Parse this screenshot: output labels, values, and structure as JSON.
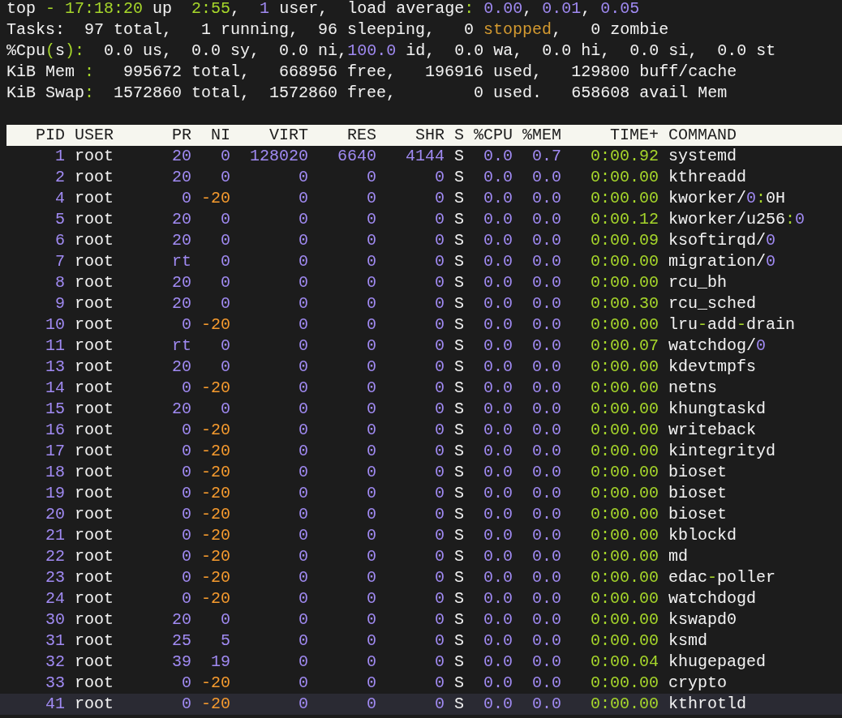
{
  "summary": [
    [
      {
        "text": "top ",
        "kind": "text"
      },
      {
        "text": "-",
        "kind": "accent"
      },
      {
        "text": " 17:18:20",
        "kind": "accent"
      },
      {
        "text": " up  ",
        "kind": "text"
      },
      {
        "text": "2:55",
        "kind": "accent"
      },
      {
        "text": ",  ",
        "kind": "text"
      },
      {
        "text": "1",
        "kind": "num"
      },
      {
        "text": " user,  load average",
        "kind": "text"
      },
      {
        "text": ":",
        "kind": "accent"
      },
      {
        "text": " 0.00",
        "kind": "num"
      },
      {
        "text": ", ",
        "kind": "text"
      },
      {
        "text": "0.01",
        "kind": "num"
      },
      {
        "text": ", ",
        "kind": "text"
      },
      {
        "text": "0.05",
        "kind": "num"
      }
    ],
    [
      {
        "text": "Tasks:  97 total,   1 running,  96 sleeping,   0 ",
        "kind": "text"
      },
      {
        "text": "stopped",
        "kind": "warn"
      },
      {
        "text": ",   0 zombie",
        "kind": "text"
      }
    ],
    [
      {
        "text": "%Cpu",
        "kind": "text"
      },
      {
        "text": "(",
        "kind": "accent"
      },
      {
        "text": "s",
        "kind": "text"
      },
      {
        "text": "):",
        "kind": "accent"
      },
      {
        "text": "  0.0 us,  0.0 sy,  0.0 ni,",
        "kind": "text"
      },
      {
        "text": "100.0",
        "kind": "num"
      },
      {
        "text": " id,  0.0 wa,  0.0 hi,  0.0 si,  0.0 st",
        "kind": "text"
      }
    ],
    [
      {
        "text": "KiB Mem ",
        "kind": "text"
      },
      {
        "text": ":",
        "kind": "accent"
      },
      {
        "text": "   995672 total,   668956 free,   196916 used,   129800 buff/cache",
        "kind": "text"
      }
    ],
    [
      {
        "text": "KiB Swap",
        "kind": "text"
      },
      {
        "text": ":",
        "kind": "accent"
      },
      {
        "text": "  1572860 total,  1572860 free,        0 used.   658608 avail Mem",
        "kind": "text"
      }
    ]
  ],
  "table": {
    "columns": [
      {
        "label": "PID",
        "kind": "num"
      },
      {
        "label": "USER",
        "kind": "text"
      },
      {
        "label": "PR",
        "kind": "num"
      },
      {
        "label": "NI",
        "kind": "signed"
      },
      {
        "label": "VIRT",
        "kind": "num"
      },
      {
        "label": "RES",
        "kind": "num"
      },
      {
        "label": "SHR",
        "kind": "num"
      },
      {
        "label": "S",
        "kind": "state"
      },
      {
        "label": "%CPU",
        "kind": "num"
      },
      {
        "label": "%MEM",
        "kind": "num"
      },
      {
        "label": "TIME+",
        "kind": "time"
      },
      {
        "label": "COMMAND",
        "kind": "command"
      }
    ],
    "rows": [
      {
        "cells": [
          "1",
          "root",
          "20",
          "0",
          "128020",
          "6640",
          "4144",
          "S",
          "0.0",
          "0.7",
          "0:00.92",
          "systemd"
        ],
        "selected": false
      },
      {
        "cells": [
          "2",
          "root",
          "20",
          "0",
          "0",
          "0",
          "0",
          "S",
          "0.0",
          "0.0",
          "0:00.00",
          "kthreadd"
        ],
        "selected": false
      },
      {
        "cells": [
          "4",
          "root",
          "0",
          "-20",
          "0",
          "0",
          "0",
          "S",
          "0.0",
          "0.0",
          "0:00.00",
          "kworker/0:0H"
        ],
        "selected": false
      },
      {
        "cells": [
          "5",
          "root",
          "20",
          "0",
          "0",
          "0",
          "0",
          "S",
          "0.0",
          "0.0",
          "0:00.12",
          "kworker/u256:0"
        ],
        "selected": false
      },
      {
        "cells": [
          "6",
          "root",
          "20",
          "0",
          "0",
          "0",
          "0",
          "S",
          "0.0",
          "0.0",
          "0:00.09",
          "ksoftirqd/0"
        ],
        "selected": false
      },
      {
        "cells": [
          "7",
          "root",
          "rt",
          "0",
          "0",
          "0",
          "0",
          "S",
          "0.0",
          "0.0",
          "0:00.00",
          "migration/0"
        ],
        "selected": false
      },
      {
        "cells": [
          "8",
          "root",
          "20",
          "0",
          "0",
          "0",
          "0",
          "S",
          "0.0",
          "0.0",
          "0:00.00",
          "rcu_bh"
        ],
        "selected": false
      },
      {
        "cells": [
          "9",
          "root",
          "20",
          "0",
          "0",
          "0",
          "0",
          "S",
          "0.0",
          "0.0",
          "0:00.30",
          "rcu_sched"
        ],
        "selected": false
      },
      {
        "cells": [
          "10",
          "root",
          "0",
          "-20",
          "0",
          "0",
          "0",
          "S",
          "0.0",
          "0.0",
          "0:00.00",
          "lru-add-drain"
        ],
        "selected": false
      },
      {
        "cells": [
          "11",
          "root",
          "rt",
          "0",
          "0",
          "0",
          "0",
          "S",
          "0.0",
          "0.0",
          "0:00.07",
          "watchdog/0"
        ],
        "selected": false
      },
      {
        "cells": [
          "13",
          "root",
          "20",
          "0",
          "0",
          "0",
          "0",
          "S",
          "0.0",
          "0.0",
          "0:00.00",
          "kdevtmpfs"
        ],
        "selected": false
      },
      {
        "cells": [
          "14",
          "root",
          "0",
          "-20",
          "0",
          "0",
          "0",
          "S",
          "0.0",
          "0.0",
          "0:00.00",
          "netns"
        ],
        "selected": false
      },
      {
        "cells": [
          "15",
          "root",
          "20",
          "0",
          "0",
          "0",
          "0",
          "S",
          "0.0",
          "0.0",
          "0:00.00",
          "khungtaskd"
        ],
        "selected": false
      },
      {
        "cells": [
          "16",
          "root",
          "0",
          "-20",
          "0",
          "0",
          "0",
          "S",
          "0.0",
          "0.0",
          "0:00.00",
          "writeback"
        ],
        "selected": false
      },
      {
        "cells": [
          "17",
          "root",
          "0",
          "-20",
          "0",
          "0",
          "0",
          "S",
          "0.0",
          "0.0",
          "0:00.00",
          "kintegrityd"
        ],
        "selected": false
      },
      {
        "cells": [
          "18",
          "root",
          "0",
          "-20",
          "0",
          "0",
          "0",
          "S",
          "0.0",
          "0.0",
          "0:00.00",
          "bioset"
        ],
        "selected": false
      },
      {
        "cells": [
          "19",
          "root",
          "0",
          "-20",
          "0",
          "0",
          "0",
          "S",
          "0.0",
          "0.0",
          "0:00.00",
          "bioset"
        ],
        "selected": false
      },
      {
        "cells": [
          "20",
          "root",
          "0",
          "-20",
          "0",
          "0",
          "0",
          "S",
          "0.0",
          "0.0",
          "0:00.00",
          "bioset"
        ],
        "selected": false
      },
      {
        "cells": [
          "21",
          "root",
          "0",
          "-20",
          "0",
          "0",
          "0",
          "S",
          "0.0",
          "0.0",
          "0:00.00",
          "kblockd"
        ],
        "selected": false
      },
      {
        "cells": [
          "22",
          "root",
          "0",
          "-20",
          "0",
          "0",
          "0",
          "S",
          "0.0",
          "0.0",
          "0:00.00",
          "md"
        ],
        "selected": false
      },
      {
        "cells": [
          "23",
          "root",
          "0",
          "-20",
          "0",
          "0",
          "0",
          "S",
          "0.0",
          "0.0",
          "0:00.00",
          "edac-poller"
        ],
        "selected": false
      },
      {
        "cells": [
          "24",
          "root",
          "0",
          "-20",
          "0",
          "0",
          "0",
          "S",
          "0.0",
          "0.0",
          "0:00.00",
          "watchdogd"
        ],
        "selected": false
      },
      {
        "cells": [
          "30",
          "root",
          "20",
          "0",
          "0",
          "0",
          "0",
          "S",
          "0.0",
          "0.0",
          "0:00.00",
          "kswapd0"
        ],
        "selected": false
      },
      {
        "cells": [
          "31",
          "root",
          "25",
          "5",
          "0",
          "0",
          "0",
          "S",
          "0.0",
          "0.0",
          "0:00.00",
          "ksmd"
        ],
        "selected": false
      },
      {
        "cells": [
          "32",
          "root",
          "39",
          "19",
          "0",
          "0",
          "0",
          "S",
          "0.0",
          "0.0",
          "0:00.04",
          "khugepaged"
        ],
        "selected": false
      },
      {
        "cells": [
          "33",
          "root",
          "0",
          "-20",
          "0",
          "0",
          "0",
          "S",
          "0.0",
          "0.0",
          "0:00.00",
          "crypto"
        ],
        "selected": false
      },
      {
        "cells": [
          "41",
          "root",
          "0",
          "-20",
          "0",
          "0",
          "0",
          "S",
          "0.0",
          "0.0",
          "0:00.00",
          "kthrotld"
        ],
        "selected": true
      }
    ]
  }
}
